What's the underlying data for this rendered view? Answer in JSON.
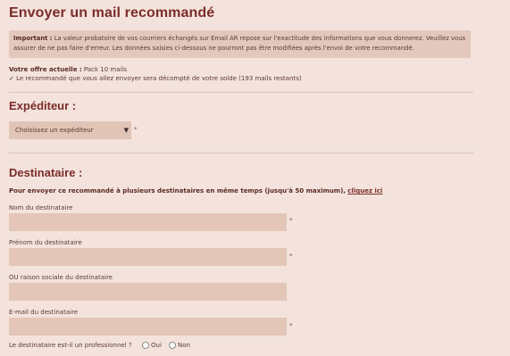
{
  "page": {
    "title": "Envoyer un mail recommandé"
  },
  "notice": {
    "bold": "Important :",
    "text": "La valeur probatoire de vos courriers échangés sur Email AR repose sur l'exactitude des informations que vous donnerez. Veuillez vous assurer de ne pas faire d'erreur. Les données saisies ci-dessous ne pourront pas être modifiées après l'envoi de votre recommandé."
  },
  "offer": {
    "label": "Votre offre actuelle :",
    "value": "Pack 10 mails",
    "check": "✓",
    "info": "Le recommandé que vous allez envoyer sera décompté de votre solde (193 mails restants)"
  },
  "expediteur": {
    "heading": "Expéditeur :",
    "select_value": "Choisissez un expéditeur",
    "required": "*"
  },
  "destinataire": {
    "heading": "Destinataire :",
    "lead_text": "Pour envoyer ce recommandé à plusieurs destinataires en même temps (jusqu'à 50 maximum),",
    "lead_link": "cliquez ici",
    "fields": [
      {
        "label": "Nom du destinataire",
        "required": "*"
      },
      {
        "label": "Prénom du destinataire",
        "required": "*"
      },
      {
        "label": "OU raison sociale du destinataire",
        "required": ""
      },
      {
        "label": "E-mail du destinataire",
        "required": "*"
      }
    ],
    "pro_question": "Le destinataire est-il un professionnel ?",
    "pro_options": [
      "Oui",
      "Non"
    ]
  },
  "colors": {
    "heading": "#7b2c2a",
    "background": "#f3e3dc",
    "field": "#e3c6b8"
  }
}
